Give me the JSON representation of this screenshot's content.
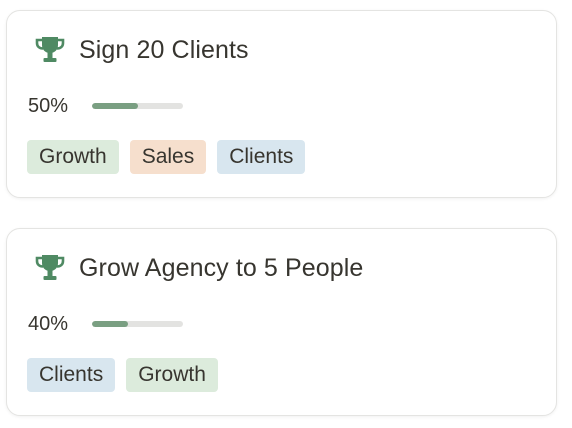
{
  "colors": {
    "progress_fill": "#7a9f82",
    "progress_track": "#e3e3e1",
    "trophy": "#4f8a63",
    "tag_growth_bg": "#dcebdc",
    "tag_sales_bg": "#f6dfcd",
    "tag_clients_bg": "#d8e6ef"
  },
  "goals": [
    {
      "icon": "trophy-icon",
      "title": "Sign 20 Clients",
      "progress_label": "50%",
      "progress": 0.5,
      "tags": [
        {
          "label": "Growth",
          "color": "#dcebdc"
        },
        {
          "label": "Sales",
          "color": "#f6dfcd"
        },
        {
          "label": "Clients",
          "color": "#d8e6ef"
        }
      ]
    },
    {
      "icon": "trophy-icon",
      "title": "Grow Agency to 5 People",
      "progress_label": "40%",
      "progress": 0.4,
      "tags": [
        {
          "label": "Clients",
          "color": "#d8e6ef"
        },
        {
          "label": "Growth",
          "color": "#dcebdc"
        }
      ]
    }
  ]
}
